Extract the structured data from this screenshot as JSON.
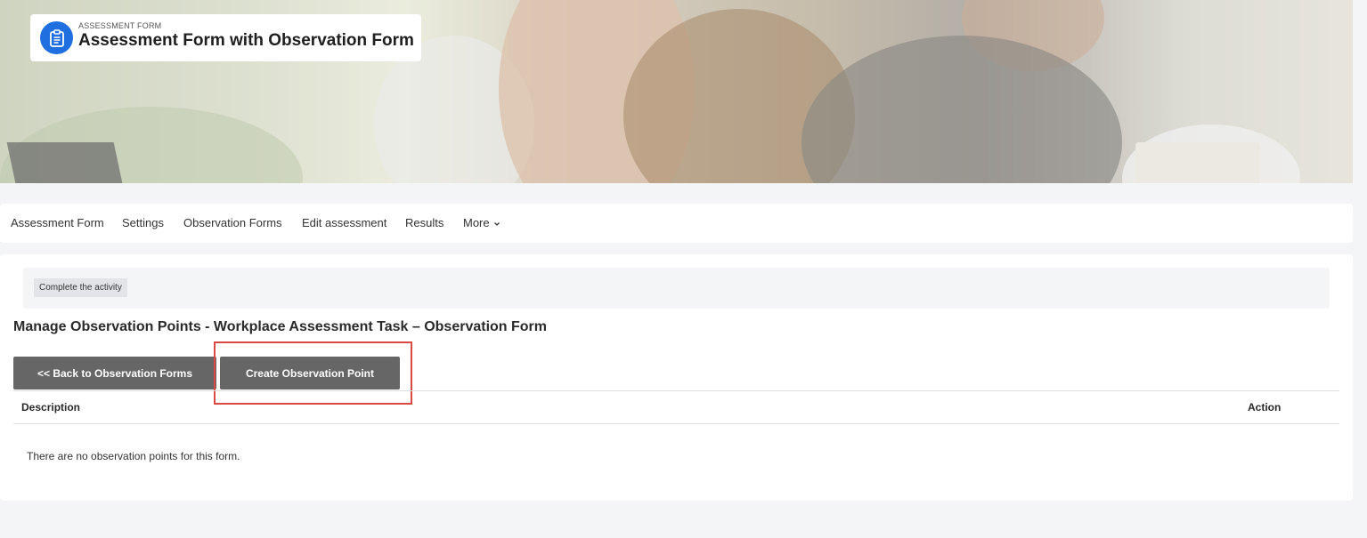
{
  "header": {
    "kicker": "ASSESSMENT FORM",
    "title": "Assessment Form with Observation Form",
    "icon": "clipboard-icon",
    "icon_color": "#1f6fe0"
  },
  "nav": {
    "items": [
      {
        "label": "Assessment Form"
      },
      {
        "label": "Settings"
      },
      {
        "label": "Observation Forms"
      },
      {
        "label": "Edit assessment"
      },
      {
        "label": "Results"
      },
      {
        "label": "More"
      }
    ],
    "more_icon": "chevron-down-icon"
  },
  "completion": {
    "tag": "Complete the activity"
  },
  "main": {
    "heading": "Manage Observation Points - Workplace Assessment Task – Observation Form",
    "back_button": "<< Back to Observation Forms",
    "create_button": "Create Observation Point",
    "button_color": "#666666",
    "highlight_color": "#d94a43"
  },
  "table": {
    "columns": [
      "Description",
      "Action"
    ],
    "empty_message": "There are no observation points for this form."
  }
}
